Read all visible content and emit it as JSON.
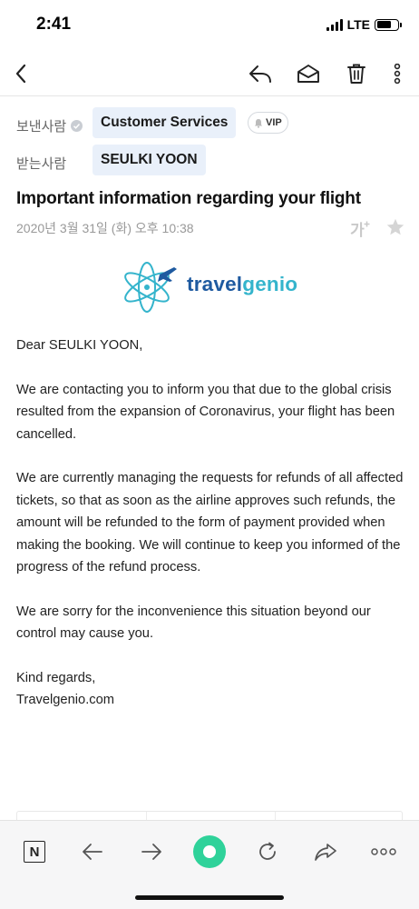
{
  "status_bar": {
    "time": "2:41",
    "network": "LTE"
  },
  "toolbar": {
    "back_icon": "chevron-left-icon",
    "reply_icon": "reply-icon",
    "read_icon": "open-envelope-icon",
    "delete_icon": "trash-icon",
    "more_icon": "more-vertical-icon"
  },
  "sender": {
    "label": "보낸사람",
    "name": "Customer Services",
    "badge": "VIP"
  },
  "recipient": {
    "label": "받는사람",
    "name": "SEULKI YOON"
  },
  "subject": "Important information regarding your flight",
  "date": "2020년 3월 31일 (화) 오후 10:38",
  "font_size_label": "가",
  "logo": {
    "part1": "travel",
    "part2": "genio"
  },
  "body": {
    "greeting": "Dear  SEULKI YOON,",
    "p1": "We are contacting you to inform you that due to the global crisis resulted from the expansion of Coronavirus, your flight has been cancelled.",
    "p2": "We are currently managing the requests for refunds of all affected tickets, so that as soon as the airline approves such refunds, the amount will be refunded to the form of payment provided when making the booking. We will continue to keep you informed of the progress of the refund process.",
    "p3": "We are sorry for the inconvenience this situation beyond our control may cause you.",
    "closing": "Kind regards,",
    "signature": "Travelgenio.com"
  },
  "bottom_bar": {
    "n_label": "N"
  },
  "colors": {
    "accent_green": "#2fd29a",
    "chip_bg": "#e9f0fa",
    "logo_blue": "#1e5aa0",
    "logo_cyan": "#34b4cc"
  }
}
